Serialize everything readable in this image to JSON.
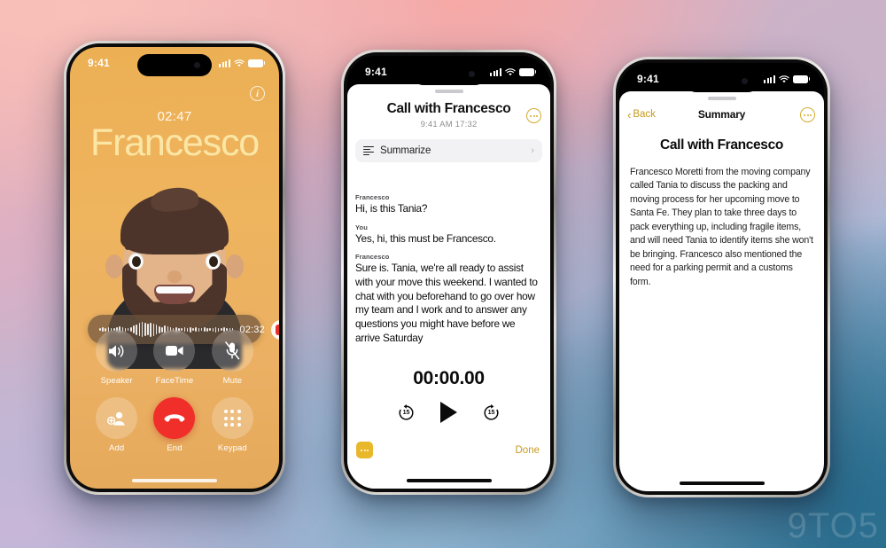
{
  "watermark": "9TO5",
  "phone1": {
    "status": {
      "time": "9:41",
      "signal_icon": "cellular-bars-icon",
      "wifi_icon": "wifi-icon",
      "battery_icon": "battery-icon"
    },
    "info_button": "i",
    "call_timer": "02:47",
    "caller_name": "Francesco",
    "avatar": "memoji-avatar",
    "recording": {
      "time": "02:32",
      "stop_label": "stop-recording"
    },
    "controls": [
      {
        "label": "Speaker",
        "icon": "speaker-icon"
      },
      {
        "label": "FaceTime",
        "icon": "video-camera-icon"
      },
      {
        "label": "Mute",
        "icon": "microphone-muted-icon"
      },
      {
        "label": "Add",
        "icon": "add-person-icon"
      },
      {
        "label": "End",
        "icon": "end-call-icon"
      },
      {
        "label": "Keypad",
        "icon": "keypad-icon"
      }
    ]
  },
  "phone2": {
    "status": {
      "time": "9:41"
    },
    "title": "Call with Francesco",
    "subtitle": "9:41 AM  17:32",
    "more_button": "more-options",
    "summarize": {
      "label": "Summarize",
      "chevron": "›"
    },
    "transcript": [
      {
        "speaker": "Francesco",
        "text": "Hi, is this Tania?"
      },
      {
        "speaker": "You",
        "text": "Yes, hi, this must be Francesco."
      },
      {
        "speaker": "Francesco",
        "text": "Sure is. Tania, we're all ready to assist with your move this weekend. I wanted to chat with you beforehand to go over how my team and I work and to answer any questions you might have before we arrive Saturday"
      }
    ],
    "player": {
      "time": "00:00.00",
      "skip_back": "15",
      "skip_forward": "15",
      "play_label": "play",
      "transcript_badge": "transcript-icon",
      "done_label": "Done"
    }
  },
  "phone3": {
    "status": {
      "time": "9:41"
    },
    "back_label": "Back",
    "nav_title": "Summary",
    "title": "Call with Francesco",
    "more_button": "more-options",
    "body": "Francesco Moretti from the moving company called Tania to discuss the packing and moving process for her upcoming move to Santa Fe. They plan to take three days to pack everything up, including fragile items, and will need Tania to identify items she won't be bringing. Francesco also mentioned the need for a parking permit and a customs form."
  },
  "colors": {
    "call_bg": "#ecb05c",
    "caller_name": "#fbe6a6",
    "end_red": "#f02f2a",
    "accent_yellow": "#c79a1e",
    "badge_yellow": "#e8b72a"
  }
}
